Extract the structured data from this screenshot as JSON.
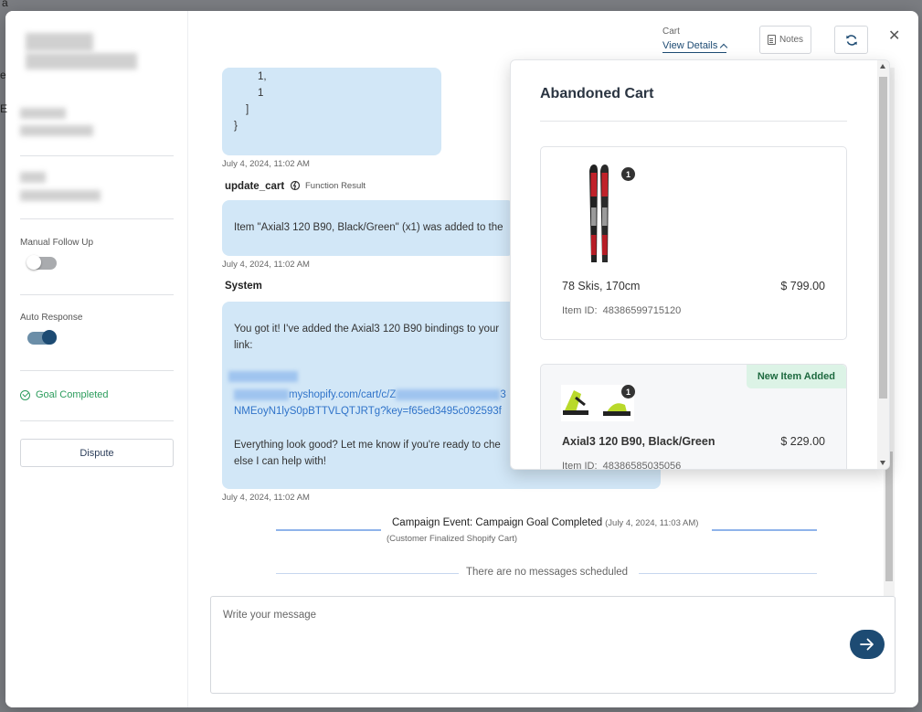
{
  "background": {
    "fragments": [
      "a",
      "e",
      "E"
    ]
  },
  "sidebar": {
    "manual_follow_up_label": "Manual Follow Up",
    "manual_follow_up_on": false,
    "auto_response_label": "Auto Response",
    "auto_response_on": true,
    "goal_label": "Goal Completed",
    "dispute_label": "Dispute"
  },
  "header": {
    "cart_label": "Cart",
    "view_details_label": "View Details",
    "notes_label": "Notes",
    "close_symbol": "✕"
  },
  "chat": {
    "code_lines": [
      "1,",
      "1",
      "]",
      "}"
    ],
    "msg1_time": "July 4, 2024, 11:02 AM",
    "function_sender": "update_cart",
    "function_tag": "Function Result",
    "function_text": "Item \"Axial3 120 B90, Black/Green\" (x1) was added to the",
    "msg2_time": "July 4, 2024, 11:02 AM",
    "system_sender": "System",
    "system_line1": "You got it! I've added the Axial3 120 B90 bindings to your",
    "system_line2": "link:",
    "link_part1": "myshopify.com/cart/c/Z",
    "link_part1_end": "3",
    "link_part2": "NMEoyN1lyS0pBTTVLQTJRTg?key=f65ed3495c092593f",
    "system_line4": "Everything look good? Let me know if you're ready to che",
    "system_line5": "else I can help with!",
    "msg3_time": "July 4, 2024, 11:02 AM",
    "event_text": "Campaign Event: Campaign Goal Completed",
    "event_time": "(July 4, 2024, 11:03 AM)",
    "event_sub": "(Customer Finalized Shopify Cart)",
    "no_scheduled": "There are no messages scheduled"
  },
  "composer": {
    "placeholder": "Write your message"
  },
  "cart": {
    "title": "Abandoned Cart",
    "items": [
      {
        "qty": "1",
        "name": "78 Skis, 170cm",
        "price": "$ 799.00",
        "id_label": "Item ID:",
        "id": "48386599715120",
        "new_label": ""
      },
      {
        "qty": "1",
        "name": "Axial3 120 B90, Black/Green",
        "price": "$ 229.00",
        "id_label": "Item ID:",
        "id": "48386585035056",
        "new_label": "New Item Added"
      }
    ]
  },
  "colors": {
    "accent": "#1d4b73",
    "bubble": "#d2e7f7",
    "goal_green": "#2b9c5c",
    "link_blue": "#2f73c9",
    "new_badge_bg": "#dcf3e6"
  }
}
